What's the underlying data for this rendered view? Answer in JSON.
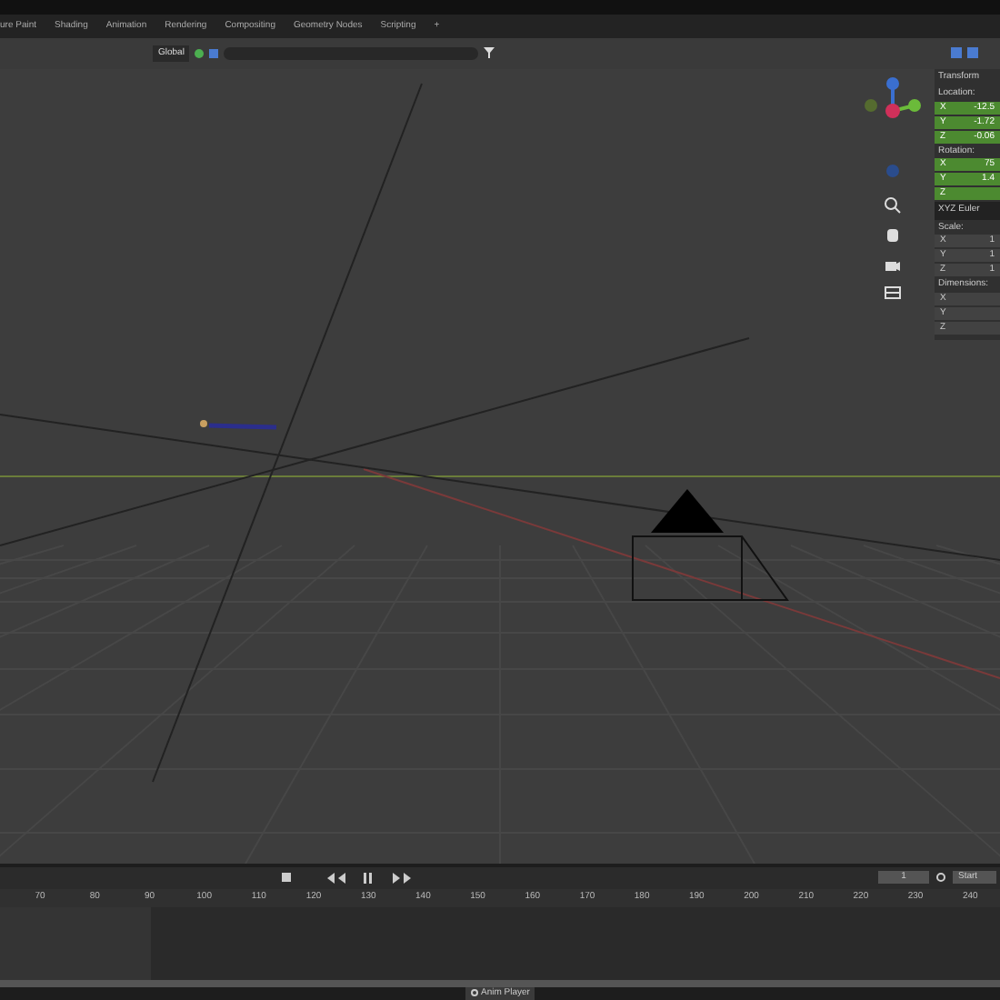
{
  "workspace_tabs": [
    {
      "label": "ure Paint"
    },
    {
      "label": "Shading"
    },
    {
      "label": "Animation"
    },
    {
      "label": "Rendering"
    },
    {
      "label": "Compositing"
    },
    {
      "label": "Geometry Nodes"
    },
    {
      "label": "Scripting"
    },
    {
      "label": "+"
    }
  ],
  "viewport_header": {
    "orientation": "Global"
  },
  "transform_panel": {
    "title": "Transform",
    "sections": [
      {
        "label": "Location:",
        "kind": "vector",
        "rows": [
          {
            "axis": "X",
            "value": "-12.5"
          },
          {
            "axis": "Y",
            "value": "-1.72"
          },
          {
            "axis": "Z",
            "value": "-0.06"
          }
        ]
      },
      {
        "label": "Rotation:",
        "kind": "vector",
        "rows": [
          {
            "axis": "X",
            "value": "75"
          },
          {
            "axis": "Y",
            "value": "1.4"
          },
          {
            "axis": "Z"
          }
        ]
      },
      {
        "label": "XYZ Euler",
        "kind": "mode"
      },
      {
        "label": "Scale:",
        "kind": "plain",
        "rows": [
          {
            "axis": "X",
            "value": "1"
          },
          {
            "axis": "Y",
            "value": "1"
          },
          {
            "axis": "Z",
            "value": "1"
          }
        ]
      },
      {
        "label": "Dimensions:",
        "kind": "plain",
        "rows": [
          {
            "axis": "X"
          },
          {
            "axis": "Y"
          },
          {
            "axis": "Z"
          }
        ]
      }
    ]
  },
  "timeline": {
    "current_frame": "1",
    "start_label": "Start",
    "frame_numbers": [
      "70",
      "80",
      "90",
      "100",
      "110",
      "120",
      "130",
      "140",
      "150",
      "160",
      "170",
      "180",
      "190",
      "200",
      "210",
      "220",
      "230",
      "240"
    ]
  },
  "status_bar": {
    "anim_player": "Anim Player"
  }
}
